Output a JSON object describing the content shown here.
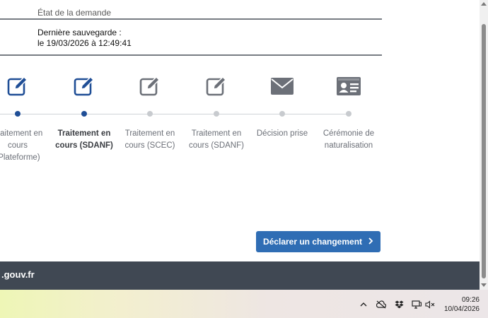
{
  "header": {
    "section_title": "État de la demande",
    "save_line1": "Dernière sauvegarde :",
    "save_line2": "le 19/03/2026 à 12:49:41"
  },
  "steps": [
    {
      "line1": "Traitement en",
      "line2": "cours",
      "line3": "(Plateforme)",
      "icon": "edit-icon",
      "status": "done"
    },
    {
      "line1": "Traitement en",
      "line2": "cours (SDANF)",
      "line3": "",
      "icon": "edit-icon",
      "status": "current"
    },
    {
      "line1": "Traitement en",
      "line2": "cours (SCEC)",
      "line3": "",
      "icon": "edit-icon",
      "status": "pending"
    },
    {
      "line1": "Traitement en",
      "line2": "cours (SDANF)",
      "line3": "",
      "icon": "edit-icon",
      "status": "pending"
    },
    {
      "line1": "Décision prise",
      "line2": "",
      "line3": "",
      "icon": "envelope-icon",
      "status": "pending"
    },
    {
      "line1": "Cérémonie de",
      "line2": "naturalisation",
      "line3": "",
      "icon": "id-card-icon",
      "status": "pending"
    }
  ],
  "actions": {
    "declare_change_label": "Déclarer un changement"
  },
  "footer": {
    "domain_text": ".gouv.fr"
  },
  "taskbar": {
    "time": "09:26",
    "date": "10/04/2026"
  },
  "colors": {
    "done": "#1f4e96",
    "pending": "#6c7078",
    "dot_pending": "#c8cbcf",
    "button": "#2f6db4",
    "footer": "#404853"
  }
}
